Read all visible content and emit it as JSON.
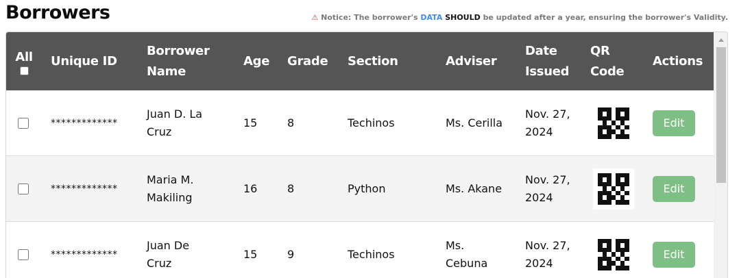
{
  "page": {
    "title": "Borrowers",
    "notice": {
      "icon": "warning-icon",
      "prefix": "Notice: The borrower's ",
      "data_word": "DATA",
      "should_word": "SHOULD",
      "suffix": " be updated after a year, ensuring the borrower's Validity."
    }
  },
  "table": {
    "headers": {
      "all": "All",
      "unique_id": "Unique ID",
      "borrower_name_1": "Borrower",
      "borrower_name_2": "Name",
      "age": "Age",
      "grade": "Grade",
      "section": "Section",
      "adviser": "Adviser",
      "date_1": "Date",
      "date_2": "Issued",
      "qr_1": "QR",
      "qr_2": "Code",
      "actions": "Actions"
    },
    "rows": [
      {
        "unique_id": "*************",
        "name_1": "Juan D. La",
        "name_2": "Cruz",
        "age": "15",
        "grade": "8",
        "section": "Techinos",
        "adviser_1": "Ms. Cerilla",
        "adviser_2": "",
        "date_1": "Nov. 27,",
        "date_2": "2024",
        "action": "Edit"
      },
      {
        "unique_id": "*************",
        "name_1": "Maria M.",
        "name_2": "Makiling",
        "age": "16",
        "grade": "8",
        "section": "Python",
        "adviser_1": "Ms. Akane",
        "adviser_2": "",
        "date_1": "Nov. 27,",
        "date_2": "2024",
        "action": "Edit"
      },
      {
        "unique_id": "*************",
        "name_1": "Juan De",
        "name_2": "Cruz",
        "age": "15",
        "grade": "9",
        "section": "Techinos",
        "adviser_1": "Ms.",
        "adviser_2": "Cebuna",
        "date_1": "Nov. 27,",
        "date_2": "2024",
        "action": "Edit"
      }
    ]
  },
  "colors": {
    "header_bg": "#555555",
    "edit_button": "#7fbf85",
    "notice_data": "#3f8ee6",
    "warning": "#e03a3a"
  }
}
